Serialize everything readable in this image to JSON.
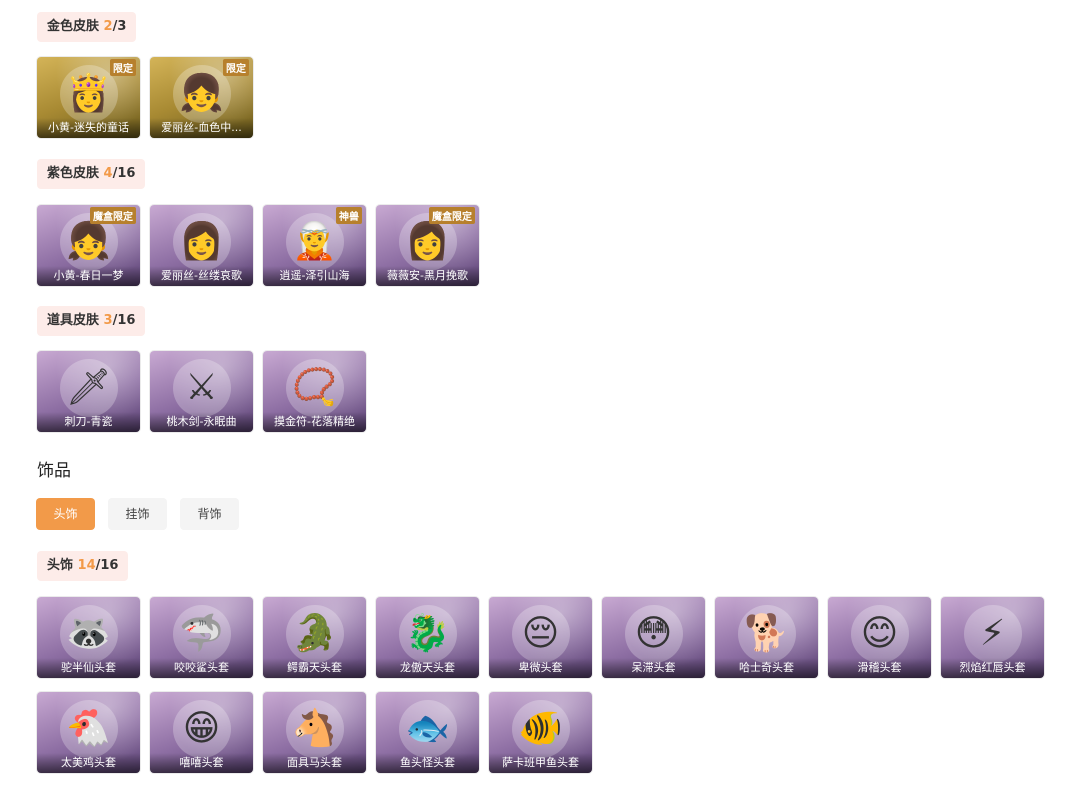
{
  "gold_skins": {
    "title": "金色皮肤",
    "owned": "2",
    "total": "/3",
    "items": [
      {
        "name": "小黄-迷失的童话",
        "tag": "限定",
        "icon": "princess-pink-hair"
      },
      {
        "name": "爱丽丝-血色中...",
        "tag": "限定",
        "icon": "alice-red-crown"
      }
    ]
  },
  "purple_skins": {
    "title": "紫色皮肤",
    "owned": "4",
    "total": "/16",
    "items": [
      {
        "name": "小黄-春日一梦",
        "tag": "魔盒限定",
        "icon": "white-hair-girl"
      },
      {
        "name": "爱丽丝-丝缕哀歌",
        "tag": "",
        "icon": "dark-hair-girl"
      },
      {
        "name": "逍遥-泽引山海",
        "tag": "神兽",
        "icon": "silver-hair-boy"
      },
      {
        "name": "薇薇安-黑月挽歌",
        "tag": "魔盒限定",
        "icon": "black-hair-lady"
      }
    ]
  },
  "item_skins": {
    "title": "道具皮肤",
    "owned": "3",
    "total": "/16",
    "items": [
      {
        "name": "刺刀-青瓷",
        "icon": "dagger"
      },
      {
        "name": "桃木剑-永眠曲",
        "icon": "sword"
      },
      {
        "name": "摸金符-花落精绝",
        "icon": "amulet"
      }
    ]
  },
  "accessories": {
    "title": "饰品",
    "tabs": [
      {
        "label": "头饰",
        "active": true
      },
      {
        "label": "挂饰",
        "active": false
      },
      {
        "label": "背饰",
        "active": false
      }
    ]
  },
  "head_items": {
    "title": "头饰",
    "owned": "14",
    "total": "/16",
    "items": [
      {
        "name": "驼半仙头套",
        "icon": "raccoon-mask"
      },
      {
        "name": "咬咬鲨头套",
        "icon": "shark-mask"
      },
      {
        "name": "鳄霸天头套",
        "icon": "crocodile-mask"
      },
      {
        "name": "龙傲天头套",
        "icon": "dragon-mask"
      },
      {
        "name": "卑微头套",
        "icon": "sad-face-mask"
      },
      {
        "name": "呆滞头套",
        "icon": "dazed-face-mask"
      },
      {
        "name": "哈士奇头套",
        "icon": "husky-mask"
      },
      {
        "name": "滑稽头套",
        "icon": "funny-face-mask"
      },
      {
        "name": "烈焰红唇头套",
        "icon": "pikachu-mask"
      },
      {
        "name": "太美鸡头套",
        "icon": "chicken-mask"
      },
      {
        "name": "嘻嘻头套",
        "icon": "grin-face-mask"
      },
      {
        "name": "面具马头套",
        "icon": "horse-mask"
      },
      {
        "name": "鱼头怪头套",
        "icon": "fish-head-mask"
      },
      {
        "name": "萨卡班甲鱼头套",
        "icon": "sacabambaspis-mask"
      }
    ]
  }
}
